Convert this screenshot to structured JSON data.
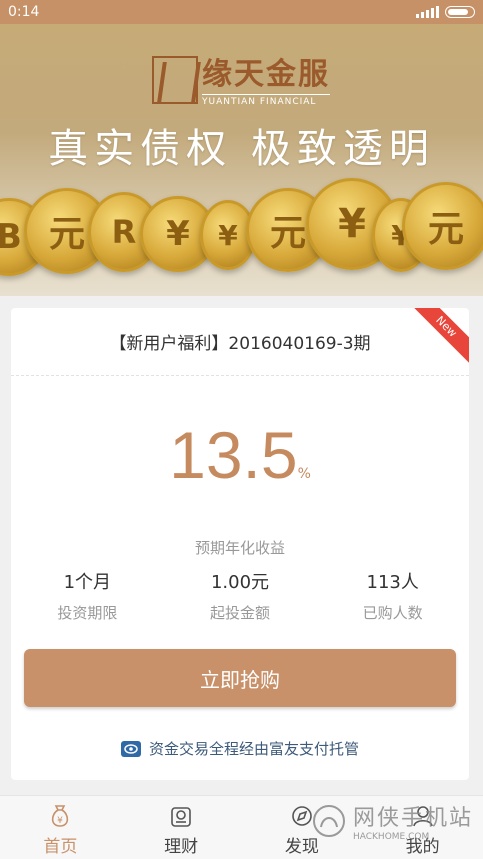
{
  "status_bar": {
    "time": "0:14"
  },
  "banner": {
    "logo_cn": "缘天金服",
    "logo_en": "YUANTIAN FINANCIAL",
    "slogan": "真实债权  极致透明",
    "coin_glyphs": [
      "B",
      "元",
      "R",
      "¥",
      "¥",
      "元",
      "¥",
      "¥",
      "元"
    ]
  },
  "product": {
    "title": "【新用户福利】2016040169-3期",
    "badge": "New",
    "rate_value": "13.5",
    "rate_unit": "%",
    "rate_label": "预期年化收益",
    "stats": [
      {
        "value": "1个月",
        "label": "投资期限"
      },
      {
        "value": "1.00元",
        "label": "起投金额"
      },
      {
        "value": "113人",
        "label": "已购人数"
      }
    ],
    "buy_label": "立即抢购",
    "trust_text": "资金交易全程经由富友支付托管"
  },
  "tabbar": {
    "tabs": [
      {
        "label": "首页",
        "icon": "home-yuan-icon",
        "active": true
      },
      {
        "label": "理财",
        "icon": "finance-icon",
        "active": false
      },
      {
        "label": "发现",
        "icon": "discover-icon",
        "active": false
      },
      {
        "label": "我的",
        "icon": "profile-icon",
        "active": false
      }
    ]
  },
  "watermark": {
    "text": "网侠手机站",
    "sub": "HACKHOME.COM"
  },
  "colors": {
    "accent": "#c8916a",
    "status_bar": "#c69167",
    "badge": "#e8463a",
    "rate": "#c68a5f"
  }
}
